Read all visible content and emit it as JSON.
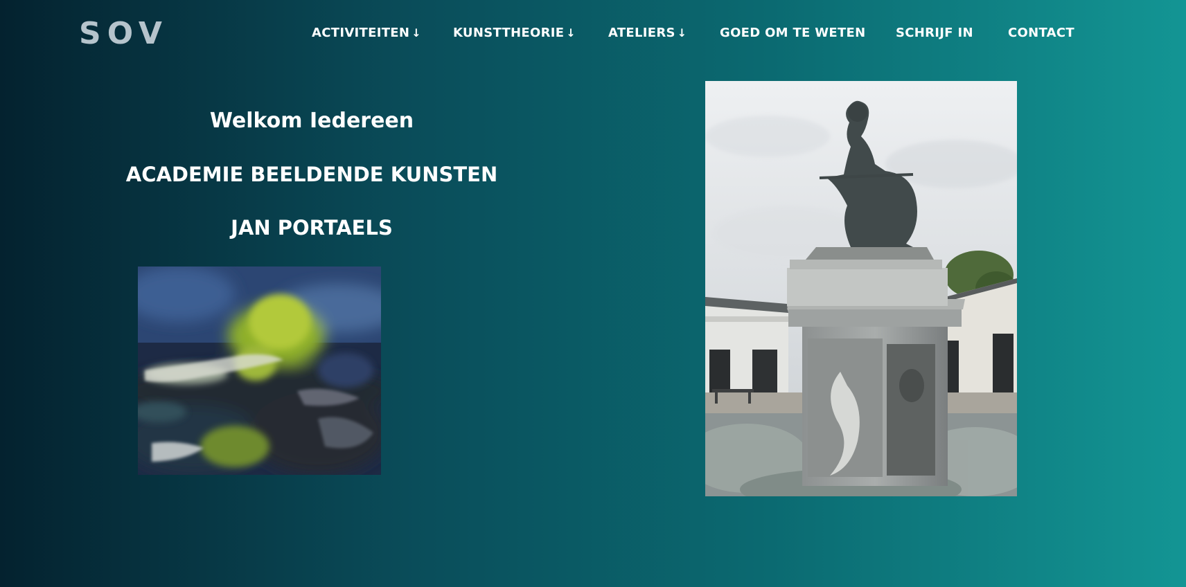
{
  "header": {
    "logo": "SOV",
    "nav": [
      {
        "label": "ACTIVITEITEN",
        "arrow": "↓"
      },
      {
        "label": "KUNSTTHEORIE",
        "arrow": "↓"
      },
      {
        "label": "ATELIERS",
        "arrow": "↓"
      },
      {
        "label": "GOED OM TE WETEN",
        "arrow": ""
      },
      {
        "label": "SCHRIJF IN",
        "arrow": ""
      },
      {
        "label": "CONTACT",
        "arrow": ""
      }
    ]
  },
  "main": {
    "welcome": "Welkom Iedereen",
    "academy": "ACADEMIE BEELDENDE KUNSTEN",
    "name": "JAN PORTAELS"
  },
  "colors": {
    "gradient_left": "#04222f",
    "gradient_right": "#139594",
    "logo": "#b6c4cc",
    "text": "#ffffff"
  }
}
